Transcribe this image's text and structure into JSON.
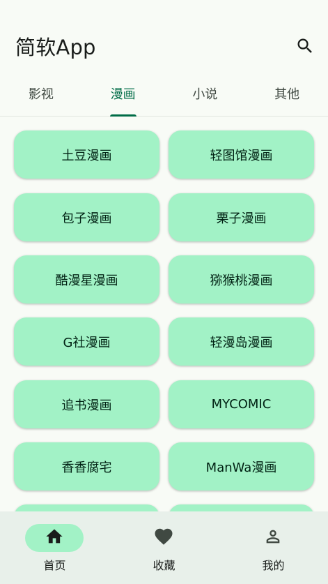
{
  "app_bar": {
    "title": "简软App",
    "search_icon": "search-icon"
  },
  "tabs": [
    {
      "label": "影视",
      "active": false
    },
    {
      "label": "漫画",
      "active": true
    },
    {
      "label": "小说",
      "active": false
    },
    {
      "label": "其他",
      "active": false
    }
  ],
  "sources": [
    "土豆漫画",
    "轻图馆漫画",
    "包子漫画",
    "栗子漫画",
    "酷漫星漫画",
    "猕猴桃漫画",
    "G社漫画",
    "轻漫岛漫画",
    "追书漫画",
    "MYCOMIC",
    "香香腐宅",
    "ManWa漫画",
    "",
    ""
  ],
  "bottom_nav": [
    {
      "label": "首页",
      "icon": "home-icon",
      "active": true
    },
    {
      "label": "收藏",
      "icon": "heart-icon",
      "active": false
    },
    {
      "label": "我的",
      "icon": "person-icon",
      "active": false
    }
  ],
  "colors": {
    "background": "#f8fbf6",
    "card": "#a2f2c6",
    "accent": "#006c47",
    "nav_background": "#e8f0ea"
  }
}
